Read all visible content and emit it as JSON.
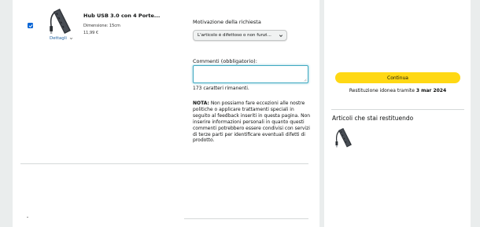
{
  "product": {
    "title": "Hub USB 3.0 con 4 Porte...",
    "dimension": "Dimensione: 15cm",
    "price": "11,99 €",
    "details_link": "Dettagli",
    "selected": true
  },
  "reason": {
    "label": "Motivazione della richiesta",
    "selected": "L'articolo è difettoso o non funzi..."
  },
  "comments": {
    "label": "Commenti (obbligatorio):",
    "value": "",
    "chars_remaining": "173 caratteri rimanenti."
  },
  "note": {
    "prefix": "NOTA:",
    "text": " Non possiamo fare eccezioni alle nostre politiche o applicare trattamenti speciali in seguito al feedback inseriti in questa pagina. Non inserire informazioni personali in quanto questi commenti potrebbero essere condivisi con servizi di terze parti per identificare eventuali difetti di prodotto."
  },
  "sidebar": {
    "continue_label": "Continua",
    "eligibility_prefix": "Restituzione idonea tramite ",
    "eligibility_date": "3 mar 2024",
    "returning_title": "Articoli che stai restituendo"
  },
  "colors": {
    "accent_button": "#ffd814",
    "link": "#2162a1",
    "checkbox": "#0a66d6",
    "focus_border": "#3fa9c1",
    "background": "#eaeded"
  },
  "icons": {
    "checkbox": "check-icon",
    "details_toggle": "chevron-down-icon",
    "select": "chevron-down-icon",
    "textarea": "resize-grip-icon"
  }
}
